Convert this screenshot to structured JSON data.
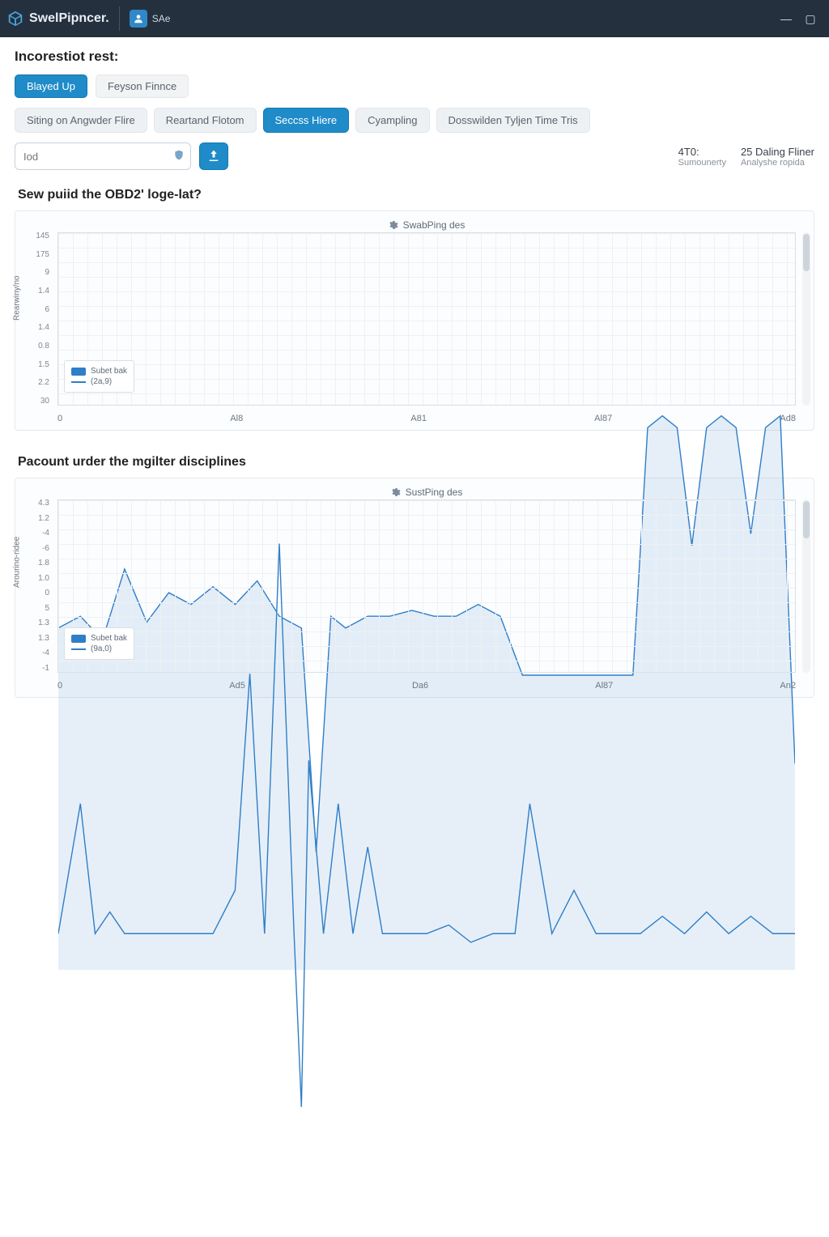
{
  "colors": {
    "accent": "#1f8bc9",
    "header": "#24303d",
    "series": "#2f7ec8"
  },
  "header": {
    "brand": "SwelPipncer.",
    "badge_label": "SAe"
  },
  "page": {
    "title": "Incorestiot rest:"
  },
  "pills": {
    "primary": "Blayed Up",
    "secondary": "Feyson Finnce"
  },
  "tabs": [
    {
      "label": "Siting on Angwder Flire",
      "active": false
    },
    {
      "label": "Reartand Flotom",
      "active": false
    },
    {
      "label": "Seccss Hiere",
      "active": true
    },
    {
      "label": "Cyampling",
      "active": false
    },
    {
      "label": "Dosswilden Tyljen Time Tris",
      "active": false
    }
  ],
  "search": {
    "placeholder": "Iod"
  },
  "meta": {
    "col1_top": "4T0:",
    "col1_bottom": "Sumounerty",
    "col2_top": "25 Daling Fliner",
    "col2_bottom": "Analyshe ropida"
  },
  "panel1": {
    "title": "Sew puiid the OBD2' loge-lat?",
    "chart_label": "SwabPing des",
    "legend1": "Subet bak",
    "legend2": "(2a,9)"
  },
  "panel2": {
    "title": "Pacount urder the mgilter disciplines",
    "chart_label": "SustPing des",
    "legend1": "Subet bak",
    "legend2": "(9a,0)"
  },
  "chart_data": [
    {
      "type": "line",
      "title": "SwabPing des",
      "xlabel": "",
      "ylabel": "Rearwiny/no",
      "xlim": [
        0,
        100
      ],
      "ylim": [
        20,
        145
      ],
      "x_ticks": [
        "0",
        "Al8",
        "A81",
        "Al87",
        "Ad8"
      ],
      "y_ticks": [
        "145",
        "175",
        "9",
        "1.4",
        "6",
        "1.4",
        "0.8",
        "1.5",
        "2.2",
        "30"
      ],
      "series": [
        {
          "name": "Subet bak",
          "x": [
            0,
            3,
            6,
            9,
            12,
            15,
            18,
            21,
            24,
            27,
            30,
            33,
            35,
            37,
            39,
            42,
            45,
            48,
            51,
            54,
            57,
            60,
            63,
            66,
            69,
            72,
            75,
            78,
            80,
            82,
            84,
            86,
            88,
            90,
            92,
            94,
            96,
            98,
            100
          ],
          "values": [
            78,
            80,
            76,
            88,
            79,
            84,
            82,
            85,
            82,
            86,
            80,
            78,
            40,
            80,
            78,
            80,
            80,
            81,
            80,
            80,
            82,
            80,
            70,
            70,
            70,
            70,
            70,
            70,
            112,
            114,
            112,
            92,
            112,
            114,
            112,
            94,
            112,
            114,
            55
          ]
        }
      ],
      "legend_entries": [
        "Subet bak",
        "(2a,9)"
      ]
    },
    {
      "type": "line",
      "title": "SustPing des",
      "xlabel": "",
      "ylabel": "Arourino-ridee",
      "xlim": [
        0,
        100
      ],
      "ylim": [
        -4,
        13
      ],
      "x_ticks": [
        "0",
        "Ad5",
        "Da6",
        "Al87",
        "An2"
      ],
      "y_ticks": [
        "4.3",
        "1.2",
        "-4",
        "-6",
        "1.8",
        "1.0",
        "0",
        "5",
        "1.3",
        "1.3",
        "-4",
        "-1"
      ],
      "series": [
        {
          "name": "Subet bak",
          "x": [
            0,
            3,
            5,
            7,
            9,
            12,
            15,
            18,
            21,
            24,
            26,
            28,
            30,
            32,
            33,
            34,
            36,
            38,
            40,
            42,
            44,
            47,
            50,
            53,
            56,
            59,
            62,
            64,
            67,
            70,
            73,
            76,
            79,
            82,
            85,
            88,
            91,
            94,
            97,
            100
          ],
          "values": [
            3.0,
            6.0,
            3.0,
            3.5,
            3.0,
            3.0,
            3.0,
            3.0,
            3.0,
            4.0,
            9.0,
            3.0,
            12.0,
            3.0,
            -1.0,
            7.0,
            3.0,
            6.0,
            3.0,
            5.0,
            3.0,
            3.0,
            3.0,
            3.2,
            2.8,
            3.0,
            3.0,
            6.0,
            3.0,
            4.0,
            3.0,
            3.0,
            3.0,
            3.4,
            3.0,
            3.5,
            3.0,
            3.4,
            3.0,
            3.0
          ]
        }
      ],
      "legend_entries": [
        "Subet bak",
        "(9a,0)"
      ]
    }
  ]
}
